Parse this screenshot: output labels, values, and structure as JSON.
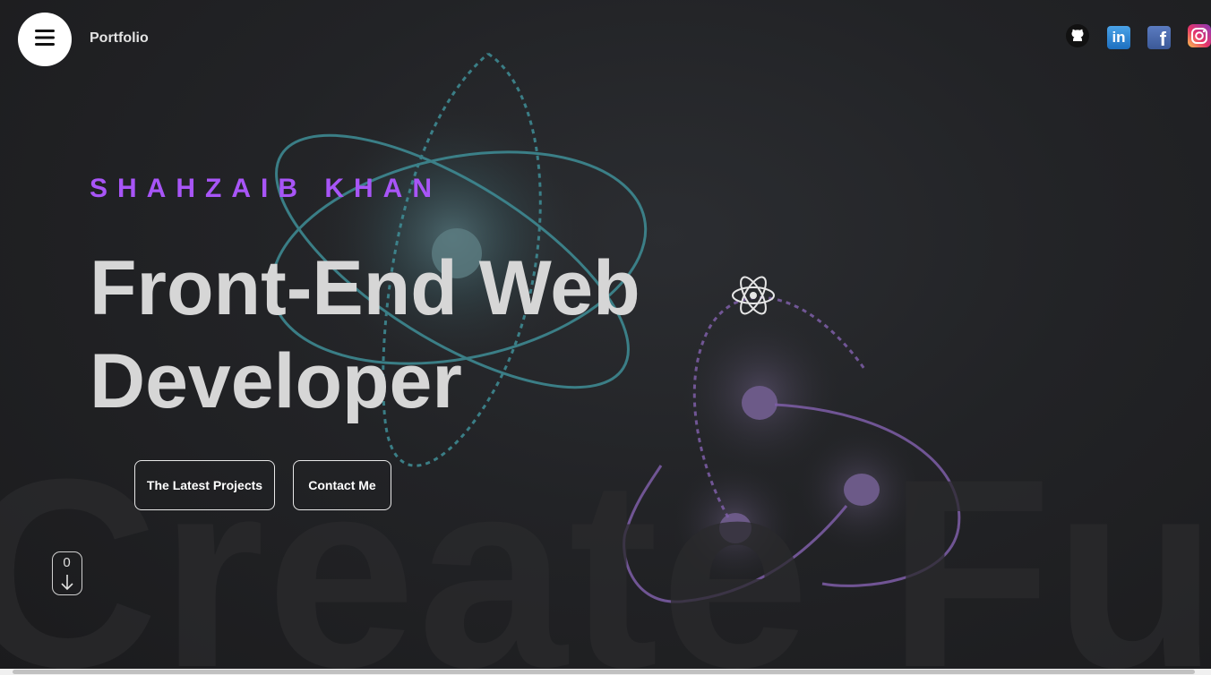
{
  "header": {
    "brand": "Portfolio",
    "menu_icon": "hamburger-menu-icon"
  },
  "social_links": [
    {
      "name": "GitHub",
      "icon": "github-icon",
      "color": "#111111"
    },
    {
      "name": "LinkedIn",
      "icon": "linkedin-icon",
      "label": "in",
      "color": "#2a7fd4"
    },
    {
      "name": "Facebook",
      "icon": "facebook-icon",
      "label": "f",
      "color": "#3b5998"
    },
    {
      "name": "Instagram",
      "icon": "instagram-icon",
      "color": "#d6249f"
    }
  ],
  "hero": {
    "subtitle": "SHAHZAIB KHAN",
    "headline_line1": "Front-End Web",
    "headline_line2": "Developer",
    "background_word": "Create Fun",
    "primary_button": "The Latest Projects",
    "secondary_button": "Contact Me",
    "scroll_count": "0"
  },
  "colors": {
    "accent_purple": "#a855f7",
    "background": "#1f2022",
    "headline": "#d6d6d6",
    "orbit_teal": "#3f8e97",
    "orbit_purple": "#7e5ea8"
  }
}
